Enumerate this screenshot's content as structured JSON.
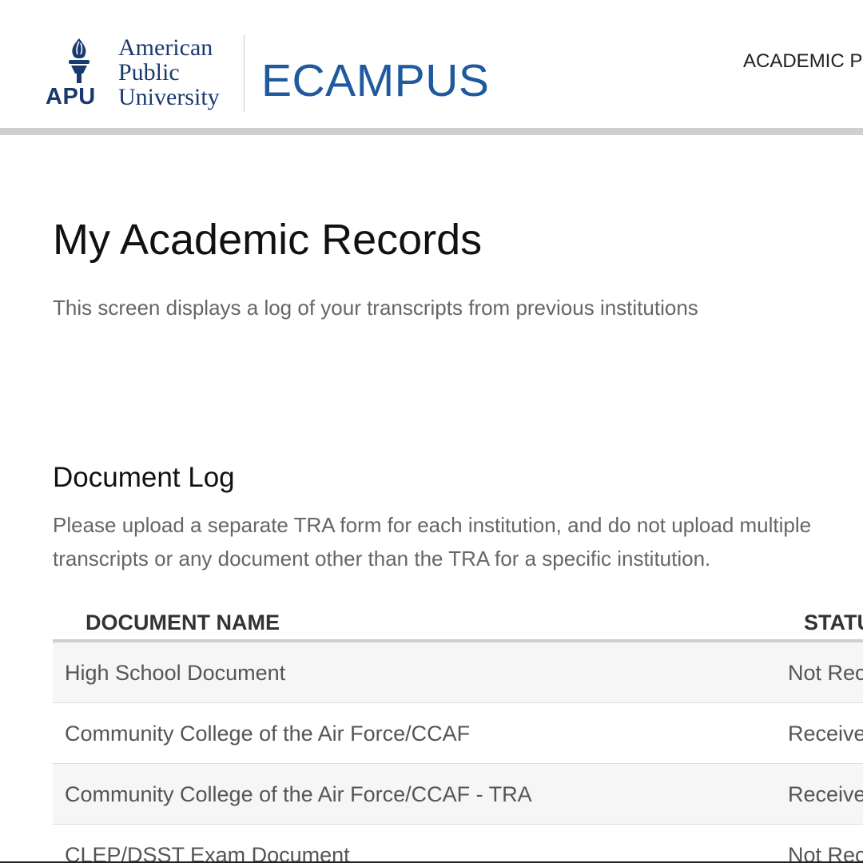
{
  "header": {
    "logo": {
      "abbr": "APU",
      "line1": "American",
      "line2": "Public",
      "line3": "University",
      "color": "#1a3a6e"
    },
    "brand": "ECAMPUS",
    "brand_color": "#1f5a9e",
    "nav": {
      "academic": "ACADEMIC P"
    }
  },
  "main": {
    "title": "My Academic Records",
    "subtitle": "This screen displays a log of your transcripts from previous institutions",
    "document_log": {
      "title": "Document Log",
      "desc_line1": "Please upload a separate TRA form for each institution, and do not upload multiple",
      "desc_line2": "transcripts or any document other than the TRA for a specific institution.",
      "columns": {
        "name": "DOCUMENT NAME",
        "status": "STATU"
      },
      "rows": [
        {
          "name": "High School Document",
          "status": "Not Rec"
        },
        {
          "name": "Community College of the Air Force/CCAF",
          "status": "Receive"
        },
        {
          "name": "Community College of the Air Force/CCAF - TRA",
          "status": "Receive"
        },
        {
          "name": "CLEP/DSST Exam Document",
          "status": "Not Rec"
        }
      ]
    }
  },
  "icons": {
    "logo_emblem": "torch-icon"
  }
}
